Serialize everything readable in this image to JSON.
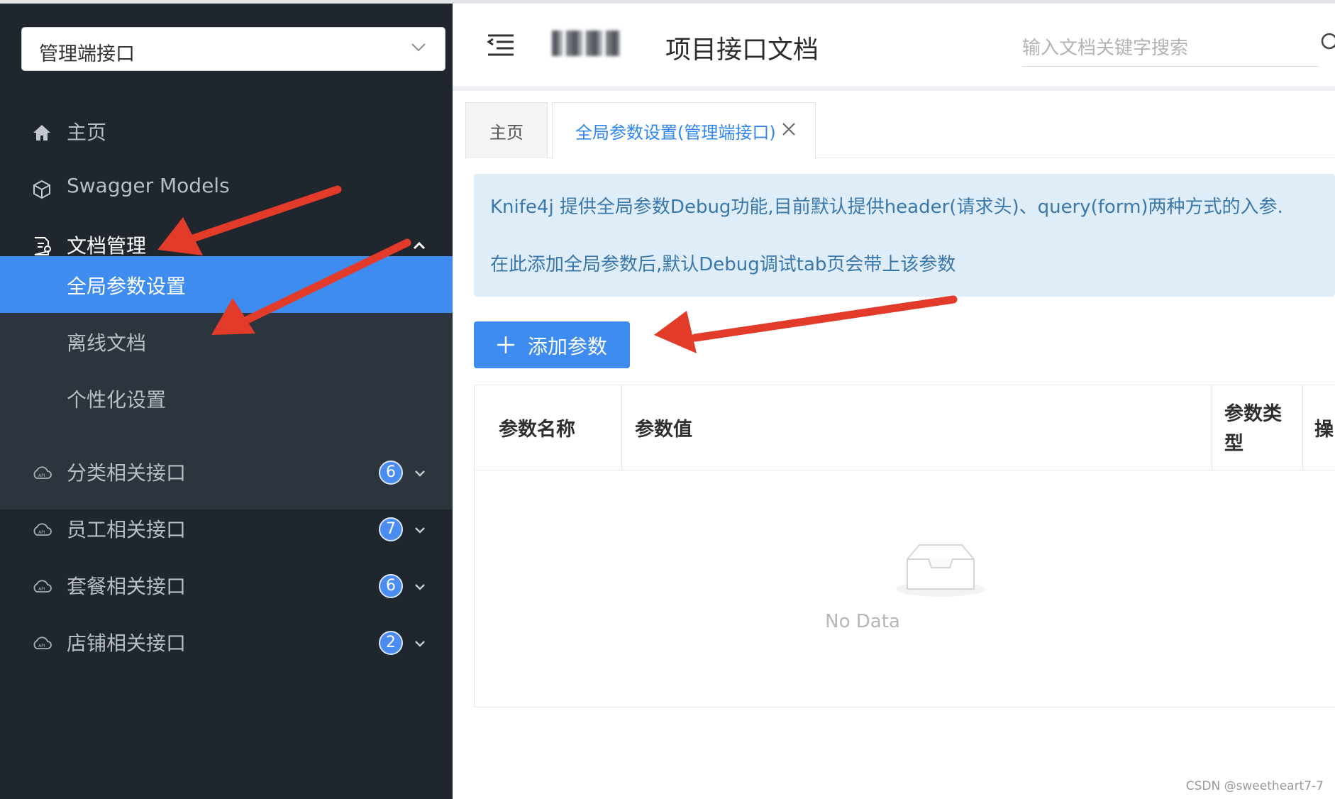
{
  "sidebar": {
    "group_select": {
      "value": "管理端接口"
    },
    "items": [
      {
        "label": "主页",
        "icon": "home-icon"
      },
      {
        "label": "Swagger Models",
        "icon": "cube-icon"
      },
      {
        "label": "文档管理",
        "icon": "document-gear-icon",
        "expanded": true,
        "children": [
          {
            "label": "全局参数设置",
            "active": true
          },
          {
            "label": "离线文档"
          },
          {
            "label": "个性化设置"
          }
        ]
      },
      {
        "label": "分类相关接口",
        "icon": "api-cloud-icon",
        "count": "6"
      },
      {
        "label": "员工相关接口",
        "icon": "api-cloud-icon",
        "count": "7"
      },
      {
        "label": "套餐相关接口",
        "icon": "api-cloud-icon",
        "count": "6"
      },
      {
        "label": "店铺相关接口",
        "icon": "api-cloud-icon",
        "count": "2"
      }
    ]
  },
  "header": {
    "title": "项目接口文档",
    "search_placeholder": "输入文档关键字搜索"
  },
  "tabs": [
    {
      "label": "主页",
      "active": false
    },
    {
      "label": "全局参数设置(管理端接口)",
      "active": true,
      "closable": true
    }
  ],
  "info": {
    "line1": "Knife4j 提供全局参数Debug功能,目前默认提供header(请求头)、query(form)两种方式的入参.",
    "line2": "在此添加全局参数后,默认Debug调试tab页会带上该参数"
  },
  "add_button": {
    "label": "添加参数"
  },
  "table": {
    "columns": [
      "参数名称",
      "参数值",
      "参数类型",
      "操"
    ],
    "rows": [],
    "empty_text": "No Data"
  },
  "watermark": "CSDN @sweetheart7-7",
  "colors": {
    "sidebar_bg": "#1f262d",
    "submenu_bg": "#2c353e",
    "accent": "#3f8cf1",
    "info_bg": "#dfedf8",
    "annotation_arrow": "#e23b2a"
  }
}
